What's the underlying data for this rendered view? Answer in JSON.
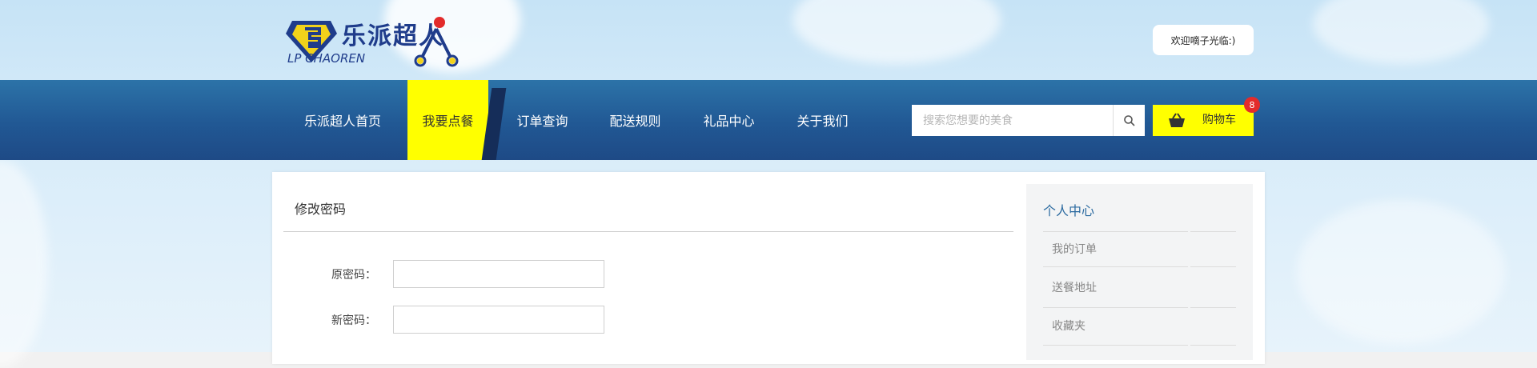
{
  "header": {
    "logo_text_cn": "乐派超人",
    "logo_text_en": "LP CHAOREN",
    "welcome": "欢迎嘀子光临:)"
  },
  "nav": {
    "items": [
      {
        "label": "乐派超人首页",
        "active": false
      },
      {
        "label": "我要点餐",
        "active": true
      },
      {
        "label": "订单查询",
        "active": false
      },
      {
        "label": "配送规则",
        "active": false
      },
      {
        "label": "礼品中心",
        "active": false
      },
      {
        "label": "关于我们",
        "active": false
      }
    ],
    "search_placeholder": "搜索您想要的美食",
    "search_icon": "search-icon",
    "cart_label": "购物车",
    "cart_icon": "basket-icon",
    "cart_count": "8",
    "colors": {
      "nav_bg": "#215894",
      "active_bg": "#ffff00",
      "badge": "#e32b2b"
    }
  },
  "main": {
    "title": "修改密码",
    "fields": [
      {
        "label": "原密码：",
        "value": ""
      },
      {
        "label": "新密码：",
        "value": ""
      }
    ]
  },
  "sidebar": {
    "title": "个人中心",
    "items": [
      {
        "label": "我的订单"
      },
      {
        "label": "送餐地址"
      },
      {
        "label": "收藏夹"
      }
    ]
  }
}
